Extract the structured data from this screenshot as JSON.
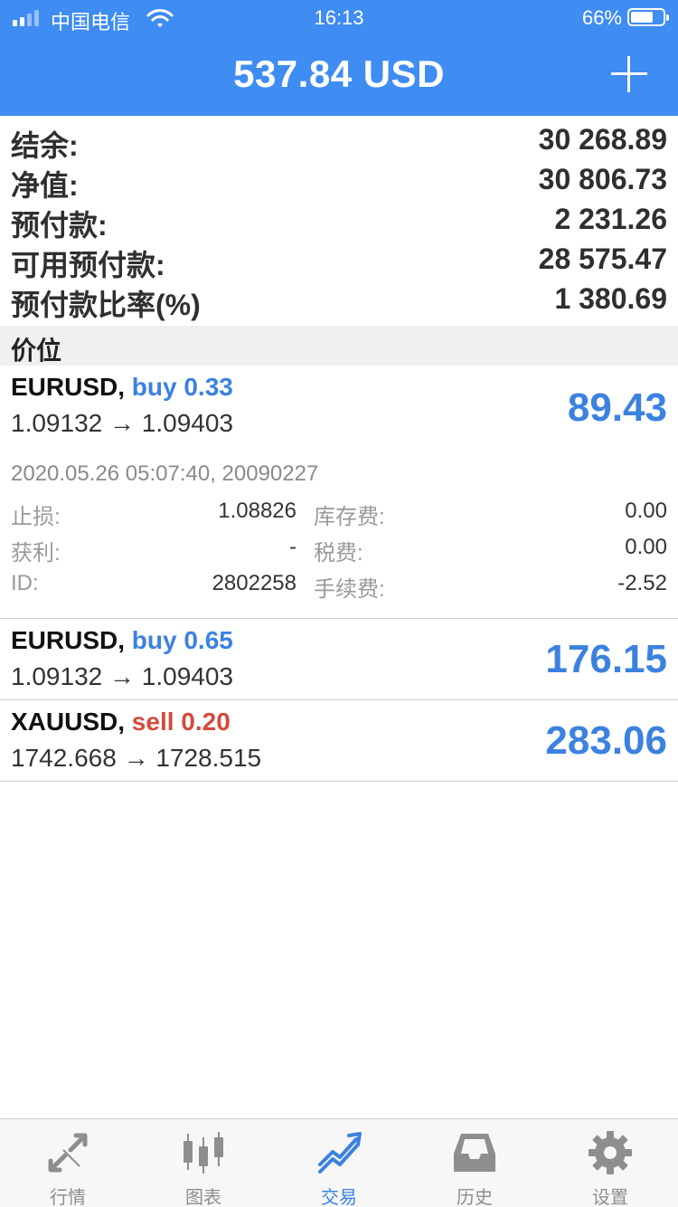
{
  "status_bar": {
    "carrier": "中国电信",
    "time": "16:13",
    "battery_percent": "66%",
    "battery_level": 0.66,
    "signal_bars": 4,
    "signal_active": 2,
    "icons": [
      "signal-icon",
      "wifi-icon",
      "battery-icon"
    ]
  },
  "header": {
    "title": "537.84 USD",
    "add_icon": "plus-icon"
  },
  "summary": [
    {
      "label": "结余:",
      "value": "30 268.89"
    },
    {
      "label": "净值:",
      "value": "30 806.73"
    },
    {
      "label": "预付款:",
      "value": "2 231.26"
    },
    {
      "label": "可用预付款:",
      "value": "28 575.47"
    },
    {
      "label": "预付款比率(%)",
      "value": "1 380.69"
    }
  ],
  "section_title": "价位",
  "positions": [
    {
      "symbol": "EURUSD,",
      "side": "buy 0.33",
      "side_type": "buy",
      "prices": "1.09132 → 1.09403",
      "profit": "89.43",
      "expanded": true,
      "details": {
        "timestamp": "2020.05.26 05:07:40, 20090227",
        "rows": [
          {
            "l1": "止损:",
            "v1": "1.08826",
            "l2": "库存费:",
            "v2": "0.00"
          },
          {
            "l1": "获利:",
            "v1": "-",
            "l2": "税费:",
            "v2": "0.00"
          },
          {
            "l1": "ID:",
            "v1": "2802258",
            "l2": "手续费:",
            "v2": "-2.52"
          }
        ]
      }
    },
    {
      "symbol": "EURUSD,",
      "side": "buy 0.65",
      "side_type": "buy",
      "prices": "1.09132 → 1.09403",
      "profit": "176.15"
    },
    {
      "symbol": "XAUUSD,",
      "side": "sell 0.20",
      "side_type": "sell",
      "prices": "1742.668 → 1728.515",
      "profit": "283.06"
    }
  ],
  "colors": {
    "header_bg": "#3f8cf2",
    "buy": "#3b82e0",
    "sell": "#d44a3a",
    "profit": "#3b82e0",
    "tab_active": "#3b82e0",
    "tab_inactive": "#8e8e8e"
  },
  "tabs": [
    {
      "label": "行情",
      "icon": "quotes-arrows-icon",
      "active": false
    },
    {
      "label": "图表",
      "icon": "candlestick-chart-icon",
      "active": false
    },
    {
      "label": "交易",
      "icon": "trade-trend-icon",
      "active": true
    },
    {
      "label": "历史",
      "icon": "history-inbox-icon",
      "active": false
    },
    {
      "label": "设置",
      "icon": "settings-gear-icon",
      "active": false
    }
  ]
}
